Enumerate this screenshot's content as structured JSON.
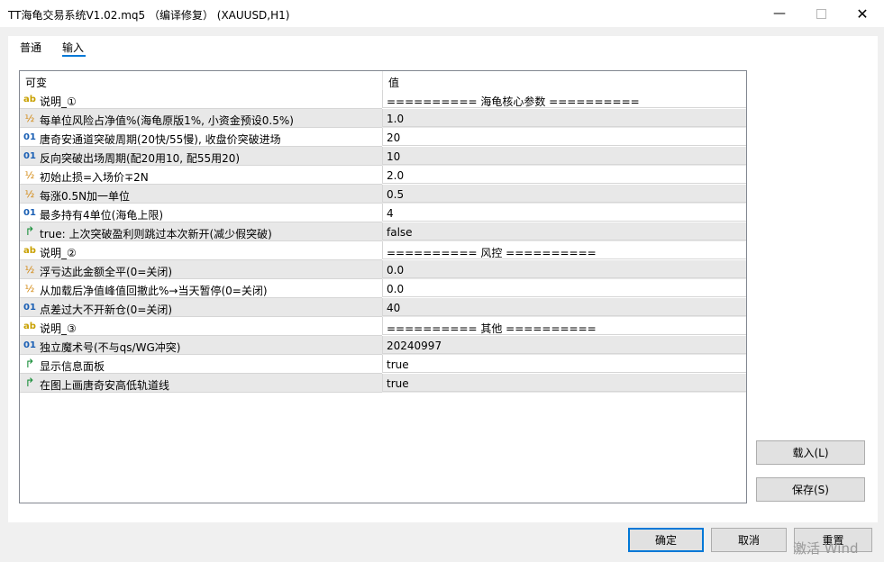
{
  "window": {
    "title": "TT海龟交易系统V1.02.mq5 （编译修复） (XAUUSD,H1)",
    "minimize_glyph": "—",
    "close_glyph": "✕"
  },
  "tabs": [
    {
      "label": "普通",
      "active": false
    },
    {
      "label": "输入",
      "active": true
    }
  ],
  "grid": {
    "col_name": "可变",
    "col_value": "值",
    "rows": [
      {
        "type": "string",
        "icon": "ab",
        "name": "说明_①",
        "value": "========== 海龟核心参数 =========="
      },
      {
        "type": "double",
        "icon": "½",
        "name": "每单位风险占净值%(海龟原版1%, 小资金预设0.5%)",
        "value": "1.0"
      },
      {
        "type": "int",
        "icon": "01",
        "name": "唐奇安通道突破周期(20快/55慢), 收盘价突破进场",
        "value": "20"
      },
      {
        "type": "int",
        "icon": "01",
        "name": "反向突破出场周期(配20用10, 配55用20)",
        "value": "10"
      },
      {
        "type": "double",
        "icon": "½",
        "name": "初始止损=入场价∓2N",
        "value": "2.0"
      },
      {
        "type": "double",
        "icon": "½",
        "name": "每涨0.5N加一单位",
        "value": "0.5"
      },
      {
        "type": "int",
        "icon": "01",
        "name": "最多持有4单位(海龟上限)",
        "value": "4"
      },
      {
        "type": "bool",
        "icon": "↱",
        "name": "true: 上次突破盈利则跳过本次新开(减少假突破)",
        "value": "false"
      },
      {
        "type": "string",
        "icon": "ab",
        "name": "说明_②",
        "value": "========== 风控 =========="
      },
      {
        "type": "double",
        "icon": "½",
        "name": "浮亏达此金额全平(0=关闭)",
        "value": "0.0"
      },
      {
        "type": "double",
        "icon": "½",
        "name": "从加载后净值峰值回撤此%→当天暂停(0=关闭)",
        "value": "0.0"
      },
      {
        "type": "int",
        "icon": "01",
        "name": "点差过大不开新仓(0=关闭)",
        "value": "40"
      },
      {
        "type": "string",
        "icon": "ab",
        "name": "说明_③",
        "value": "========== 其他 =========="
      },
      {
        "type": "int",
        "icon": "01",
        "name": "独立魔术号(不与qs/WG冲突)",
        "value": "20240997"
      },
      {
        "type": "bool",
        "icon": "↱",
        "name": "显示信息面板",
        "value": "true"
      },
      {
        "type": "bool",
        "icon": "↱",
        "name": "在图上画唐奇安高低轨道线",
        "value": "true"
      }
    ]
  },
  "buttons": {
    "load": "载入(L)",
    "save": "保存(S)",
    "ok": "确定",
    "cancel": "取消",
    "reset": "重置"
  },
  "overlay_text": "激活 Wind",
  "colors": {
    "accent": "#0078d7",
    "row_alt": "#e8e8e8"
  }
}
